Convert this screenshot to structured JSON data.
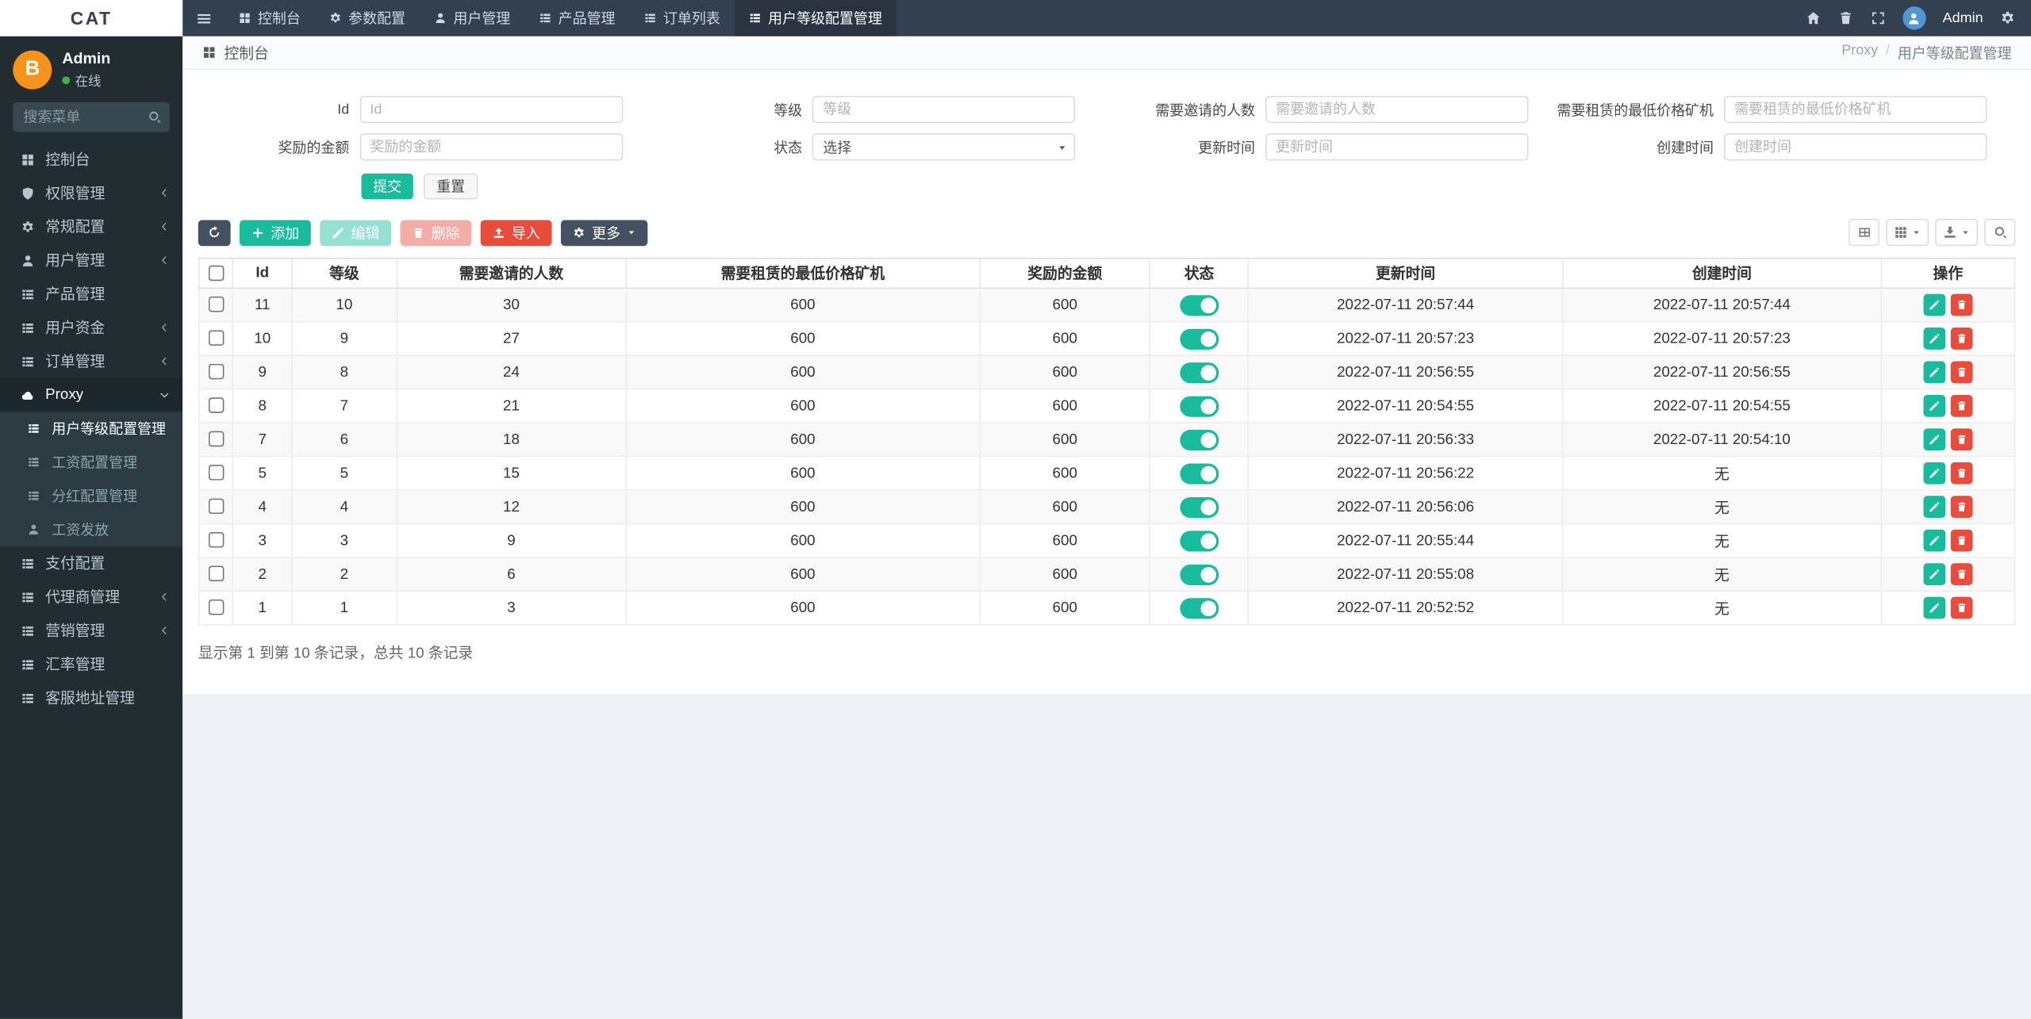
{
  "topbar": {
    "brand": "CAT",
    "username": "Admin",
    "tabs": [
      {
        "label": "控制台",
        "icon": "dashboard-icon",
        "active": false
      },
      {
        "label": "参数配置",
        "icon": "gear-icon",
        "active": false
      },
      {
        "label": "用户管理",
        "icon": "user-icon",
        "active": false
      },
      {
        "label": "产品管理",
        "icon": "list-icon",
        "active": false
      },
      {
        "label": "订单列表",
        "icon": "list-icon",
        "active": false
      },
      {
        "label": "用户等级配置管理",
        "icon": "list-icon",
        "active": true
      }
    ]
  },
  "sidebar": {
    "user_name": "Admin",
    "user_status": "在线",
    "avatar_letter": "B",
    "search_placeholder": "搜索菜单",
    "menu": [
      {
        "label": "控制台",
        "icon": "dashboard-icon"
      },
      {
        "label": "权限管理",
        "icon": "shield-icon",
        "chevron": true
      },
      {
        "label": "常规配置",
        "icon": "gear-icon",
        "chevron": true
      },
      {
        "label": "用户管理",
        "icon": "user-icon",
        "chevron": true
      },
      {
        "label": "产品管理",
        "icon": "list-icon"
      },
      {
        "label": "用户资金",
        "icon": "list-icon",
        "chevron": true
      },
      {
        "label": "订单管理",
        "icon": "list-icon",
        "chevron": true
      },
      {
        "label": "Proxy",
        "icon": "cloud-icon",
        "open": true,
        "active": true,
        "children": [
          {
            "label": "用户等级配置管理",
            "icon": "list-icon",
            "active": true
          },
          {
            "label": "工资配置管理",
            "icon": "list-icon",
            "active": false
          },
          {
            "label": "分红配置管理",
            "icon": "list-icon",
            "active": false
          },
          {
            "label": "工资发放",
            "icon": "user-icon",
            "active": false
          }
        ]
      },
      {
        "label": "支付配置",
        "icon": "list-icon"
      },
      {
        "label": "代理商管理",
        "icon": "list-icon",
        "chevron": true
      },
      {
        "label": "营销管理",
        "icon": "list-icon",
        "chevron": true
      },
      {
        "label": "汇率管理",
        "icon": "list-icon"
      },
      {
        "label": "客服地址管理",
        "icon": "list-icon"
      }
    ]
  },
  "breadcrumb": {
    "page": "控制台",
    "parent": "Proxy",
    "separator": "/",
    "current": "用户等级配置管理"
  },
  "filter": {
    "fields": [
      {
        "key": "id",
        "label": "Id",
        "placeholder": "Id",
        "type": "text"
      },
      {
        "key": "level",
        "label": "等级",
        "placeholder": "等级",
        "type": "text"
      },
      {
        "key": "invites",
        "label": "需要邀请的人数",
        "placeholder": "需要邀请的人数",
        "type": "text"
      },
      {
        "key": "min-rent",
        "label": "需要租赁的最低价格矿机",
        "placeholder": "需要租赁的最低价格矿机",
        "type": "text"
      },
      {
        "key": "reward",
        "label": "奖励的金额",
        "placeholder": "奖励的金额",
        "type": "text"
      },
      {
        "key": "status",
        "label": "状态",
        "value": "选择",
        "type": "select"
      },
      {
        "key": "updated",
        "label": "更新时间",
        "placeholder": "更新时间",
        "type": "text"
      },
      {
        "key": "created",
        "label": "创建时间",
        "placeholder": "创建时间",
        "type": "text"
      }
    ],
    "submit_label": "提交",
    "reset_label": "重置"
  },
  "toolbar": {
    "add_label": "添加",
    "edit_label": "编辑",
    "delete_label": "删除",
    "import_label": "导入",
    "more_label": "更多"
  },
  "table": {
    "columns": [
      "Id",
      "等级",
      "需要邀请的人数",
      "需要租赁的最低价格矿机",
      "奖励的金额",
      "状态",
      "更新时间",
      "创建时间",
      "操作"
    ],
    "rows": [
      {
        "id": "11",
        "level": "10",
        "invites": "30",
        "min_rent": "600",
        "reward": "600",
        "status_on": true,
        "updated": "2022-07-11 20:57:44",
        "created": "2022-07-11 20:57:44"
      },
      {
        "id": "10",
        "level": "9",
        "invites": "27",
        "min_rent": "600",
        "reward": "600",
        "status_on": true,
        "updated": "2022-07-11 20:57:23",
        "created": "2022-07-11 20:57:23"
      },
      {
        "id": "9",
        "level": "8",
        "invites": "24",
        "min_rent": "600",
        "reward": "600",
        "status_on": true,
        "updated": "2022-07-11 20:56:55",
        "created": "2022-07-11 20:56:55"
      },
      {
        "id": "8",
        "level": "7",
        "invites": "21",
        "min_rent": "600",
        "reward": "600",
        "status_on": true,
        "updated": "2022-07-11 20:54:55",
        "created": "2022-07-11 20:54:55"
      },
      {
        "id": "7",
        "level": "6",
        "invites": "18",
        "min_rent": "600",
        "reward": "600",
        "status_on": true,
        "updated": "2022-07-11 20:56:33",
        "created": "2022-07-11 20:54:10"
      },
      {
        "id": "5",
        "level": "5",
        "invites": "15",
        "min_rent": "600",
        "reward": "600",
        "status_on": true,
        "updated": "2022-07-11 20:56:22",
        "created": "无"
      },
      {
        "id": "4",
        "level": "4",
        "invites": "12",
        "min_rent": "600",
        "reward": "600",
        "status_on": true,
        "updated": "2022-07-11 20:56:06",
        "created": "无"
      },
      {
        "id": "3",
        "level": "3",
        "invites": "9",
        "min_rent": "600",
        "reward": "600",
        "status_on": true,
        "updated": "2022-07-11 20:55:44",
        "created": "无"
      },
      {
        "id": "2",
        "level": "2",
        "invites": "6",
        "min_rent": "600",
        "reward": "600",
        "status_on": true,
        "updated": "2022-07-11 20:55:08",
        "created": "无"
      },
      {
        "id": "1",
        "level": "1",
        "invites": "3",
        "min_rent": "600",
        "reward": "600",
        "status_on": true,
        "updated": "2022-07-11 20:52:52",
        "created": "无"
      }
    ],
    "summary": "显示第 1 到第 10 条记录，总共 10 条记录"
  },
  "colors": {
    "topbar_bg": "#33404f",
    "sidebar_bg": "#222d32",
    "submenu_bg": "#2c3b41",
    "accent_green": "#18bc9c",
    "danger_red": "#e74c3c",
    "dark_button": "#445160",
    "avatar_orange": "#f7931a",
    "avatar_blue": "#4e97d1",
    "content_bg": "#eef1f5"
  }
}
